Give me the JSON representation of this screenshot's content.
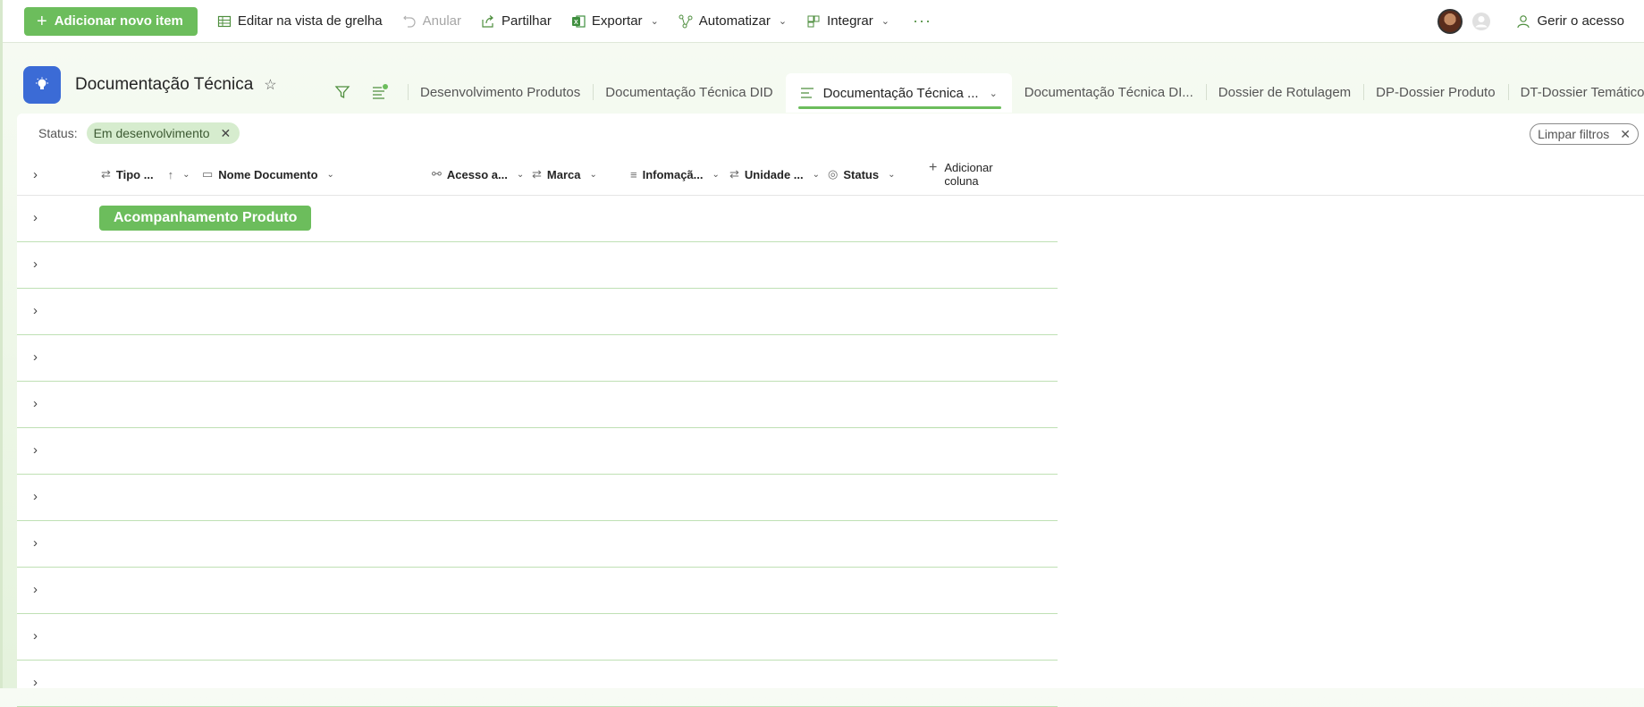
{
  "toolbar": {
    "new_item": "Adicionar novo item",
    "grid_edit": "Editar na vista de grelha",
    "undo": "Anular",
    "share": "Partilhar",
    "export": "Exportar",
    "automate": "Automatizar",
    "integrate": "Integrar",
    "more": "···",
    "manage_access": "Gerir o acesso"
  },
  "list": {
    "title": "Documentação Técnica"
  },
  "views": {
    "tabs": [
      "Desenvolvimento Produtos",
      "Documentação Técnica DID",
      "Documentação Técnica ...",
      "Documentação Técnica DI...",
      "Dossier de Rotulagem",
      "DP-Dossier Produto",
      "DT-Dossier Temático"
    ],
    "more": "···",
    "add": "+"
  },
  "filter": {
    "label": "Status:",
    "chip": "Em desenvolvimento",
    "clear": "Limpar filtros"
  },
  "columns": {
    "tipo": "Tipo ...",
    "nome": "Nome Documento",
    "acesso": "Acesso a...",
    "marca": "Marca",
    "info": "Infomaçã...",
    "unidade": "Unidade ...",
    "status": "Status",
    "add_line1": "Adicionar",
    "add_line2": "coluna"
  },
  "group": {
    "label": "Acompanhamento Produto"
  },
  "colors": {
    "accent": "#6cbd5c",
    "list_icon": "#3b6bd6"
  }
}
